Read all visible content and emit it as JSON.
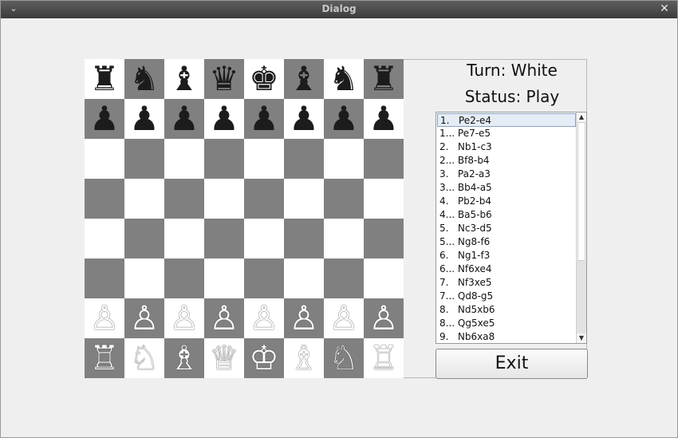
{
  "window": {
    "title": "Dialog",
    "menu_icon": "chevron-down-icon",
    "close_icon": "close-icon"
  },
  "labels": {
    "turn": "Turn: White",
    "status": "Status: Play"
  },
  "board": {
    "light_color": "#ffffff",
    "dark_color": "#808080",
    "rows": [
      [
        "♜",
        "♞",
        "♝",
        "♛",
        "♚",
        "♝",
        "♞",
        "♜"
      ],
      [
        "♟",
        "♟",
        "♟",
        "♟",
        "♟",
        "♟",
        "♟",
        "♟"
      ],
      [
        "",
        "",
        "",
        "",
        "",
        "",
        "",
        ""
      ],
      [
        "",
        "",
        "",
        "",
        "",
        "",
        "",
        ""
      ],
      [
        "",
        "",
        "",
        "",
        "",
        "",
        "",
        ""
      ],
      [
        "",
        "",
        "",
        "",
        "",
        "",
        "",
        ""
      ],
      [
        "♙",
        "♙",
        "♙",
        "♙",
        "♙",
        "♙",
        "♙",
        "♙"
      ],
      [
        "♖",
        "♘",
        "♗",
        "♕",
        "♔",
        "♗",
        "♘",
        "♖"
      ]
    ],
    "colors": [
      [
        "black",
        "black",
        "black",
        "black",
        "black",
        "black",
        "black",
        "black"
      ],
      [
        "black",
        "black",
        "black",
        "black",
        "black",
        "black",
        "black",
        "black"
      ],
      [
        "",
        "",
        "",
        "",
        "",
        "",
        "",
        ""
      ],
      [
        "",
        "",
        "",
        "",
        "",
        "",
        "",
        ""
      ],
      [
        "",
        "",
        "",
        "",
        "",
        "",
        "",
        ""
      ],
      [
        "",
        "",
        "",
        "",
        "",
        "",
        "",
        ""
      ],
      [
        "white",
        "white",
        "white",
        "white",
        "white",
        "white",
        "white",
        "white"
      ],
      [
        "white",
        "white",
        "white",
        "white",
        "white",
        "white",
        "white",
        "white"
      ]
    ]
  },
  "moves": [
    "1.   Pe2-e4",
    "1... Pe7-e5",
    "2.   Nb1-c3",
    "2... Bf8-b4",
    "3.   Pa2-a3",
    "3... Bb4-a5",
    "4.   Pb2-b4",
    "4... Ba5-b6",
    "5.   Nc3-d5",
    "5... Ng8-f6",
    "6.   Ng1-f3",
    "6... Nf6xe4",
    "7.   Nf3xe5",
    "7... Qd8-g5",
    "8.   Nd5xb6",
    "8... Qg5xe5",
    "9.   Nb6xa8"
  ],
  "selected_move_index": 0,
  "exit_label": "Exit"
}
